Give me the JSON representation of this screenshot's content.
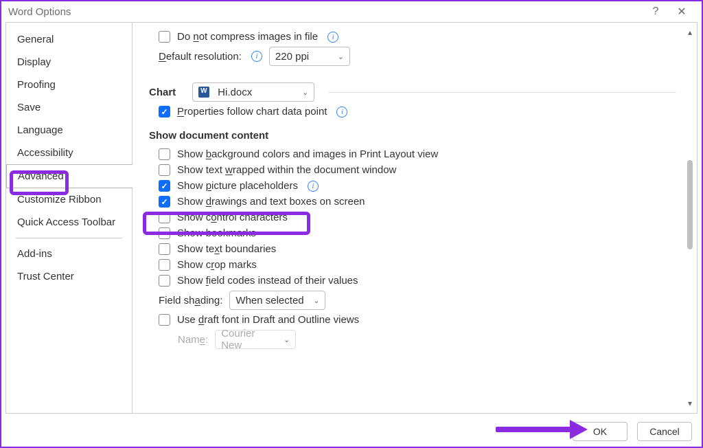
{
  "title": "Word Options",
  "nav": {
    "items": [
      "General",
      "Display",
      "Proofing",
      "Save",
      "Language",
      "Accessibility",
      "Advanced",
      "Customize Ribbon",
      "Quick Access Toolbar",
      "Add-ins",
      "Trust Center"
    ],
    "selected": "Advanced"
  },
  "content": {
    "compress_label": "Do not compress images in file",
    "default_res_label": "Default resolution:",
    "default_res_value": "220 ppi",
    "chart_label": "Chart",
    "chart_doc": "Hi.docx",
    "chart_prop_label": "Properties follow chart data point",
    "section_header": "Show document content",
    "opts": {
      "bg": {
        "label": "Show background colors and images in Print Layout view",
        "checked": false,
        "info": false,
        "u": "b"
      },
      "wrap": {
        "label": "Show text wrapped within the document window",
        "checked": false,
        "info": false,
        "u": "w"
      },
      "pic": {
        "label": "Show picture placeholders",
        "checked": true,
        "info": true,
        "u": "p"
      },
      "draw": {
        "label": "Show drawings and text boxes on screen",
        "checked": true,
        "info": false,
        "u": "d"
      },
      "ctrl": {
        "label": "Show control characters",
        "checked": false,
        "info": false,
        "u": "o"
      },
      "bkmk": {
        "label": "Show bookmarks",
        "checked": false,
        "info": false
      },
      "bound": {
        "label": "Show text boundaries",
        "checked": false,
        "info": false,
        "u": "x"
      },
      "crop": {
        "label": "Show crop marks",
        "checked": false,
        "info": false,
        "u": "r"
      },
      "field": {
        "label": "Show field codes instead of their values",
        "checked": false,
        "info": false,
        "u": "f"
      }
    },
    "field_shading_label": "Field shading:",
    "field_shading_value": "When selected",
    "draft_font_label": "Use draft font in Draft and Outline views",
    "name_label": "Name:",
    "name_value": "Courier New"
  },
  "footer": {
    "ok": "OK",
    "cancel": "Cancel"
  }
}
